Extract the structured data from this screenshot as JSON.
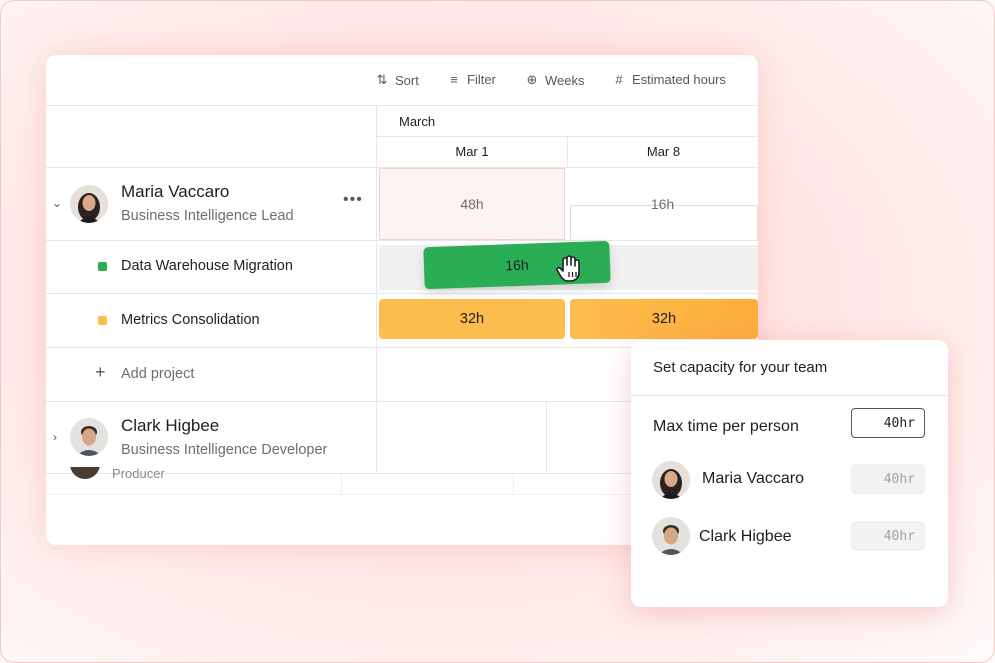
{
  "toolbar": {
    "sort": {
      "label": "Sort",
      "icon": "sort-icon"
    },
    "filter": {
      "label": "Filter",
      "icon": "filter-icon"
    },
    "weeks": {
      "label": "Weeks",
      "icon": "zoom-icon"
    },
    "estimated": {
      "label": "Estimated hours",
      "icon": "hash-icon"
    }
  },
  "timeline": {
    "month": "March",
    "weeks": [
      "Mar 1",
      "Mar 8"
    ]
  },
  "people": [
    {
      "name": "Maria Vaccaro",
      "role": "Business Intelligence Lead",
      "expanded": true,
      "capacity": [
        "48h",
        "16h"
      ],
      "projects": [
        {
          "name": "Data Warehouse Migration",
          "color": "#2aad55",
          "hours": "16h"
        },
        {
          "name": "Metrics Consolidation",
          "color": "#fdbd4d",
          "hours": [
            "32h",
            "32h"
          ]
        }
      ]
    },
    {
      "name": "Clark Higbee",
      "role": "Business Intelligence Developer",
      "expanded": false
    }
  ],
  "hidden_role": "Producer",
  "add_project": "Add project",
  "popup": {
    "title": "Set capacity for your team",
    "max_label": "Max time per person",
    "max_value": "40hr",
    "members": [
      {
        "name": "Maria Vaccaro",
        "value": "40hr"
      },
      {
        "name": "Clark Higbee",
        "value": "40hr"
      }
    ]
  },
  "colors": {
    "over_capacity": "#fdf3f2",
    "green": "#2aad55",
    "yellow": "#fdbd4d"
  }
}
